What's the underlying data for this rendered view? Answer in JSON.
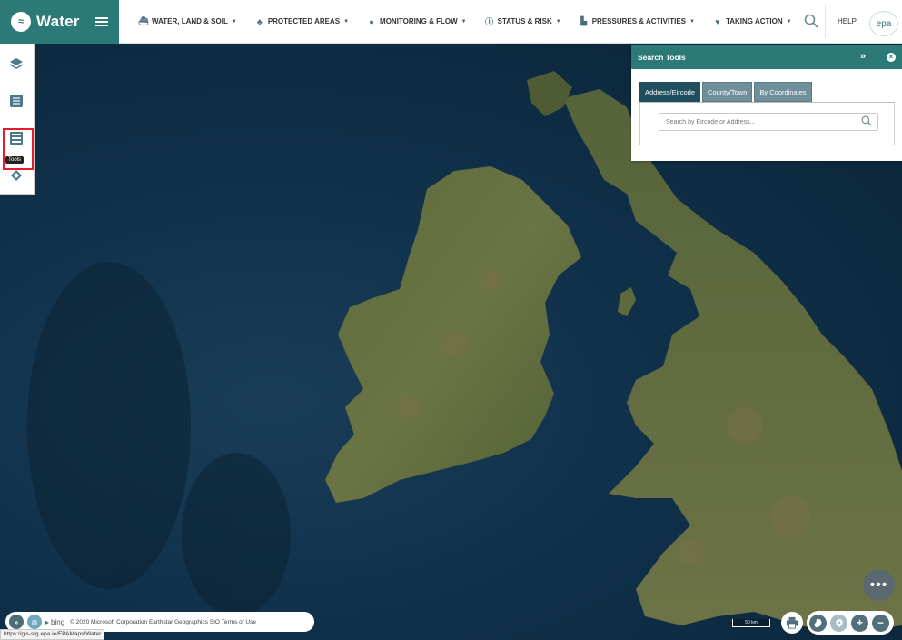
{
  "header": {
    "app_title": "Water",
    "nav": [
      {
        "label": "WATER, LAND & SOIL",
        "icon": "boat-icon"
      },
      {
        "label": "PROTECTED AREAS",
        "icon": "protected-area-icon"
      },
      {
        "label": "MONITORING & FLOW",
        "icon": "water-drop-icon"
      },
      {
        "label": "STATUS & RISK",
        "icon": "info-icon"
      },
      {
        "label": "PRESSURES & ACTIVITIES",
        "icon": "factory-icon"
      },
      {
        "label": "TAKING ACTION",
        "icon": "heart-icon"
      }
    ],
    "help_label": "HELP",
    "logo_text": "epa"
  },
  "left_toolbar": {
    "tools_tooltip": "Tools"
  },
  "search_panel": {
    "title": "Search Tools",
    "tabs": [
      "Address/Eircode",
      "County/Town",
      "By Coordinates"
    ],
    "active_tab": "Address/Eircode",
    "search_placeholder": "Search by Eircode or Address..."
  },
  "attribution": {
    "bing_label": "bing",
    "copyright": "© 2020 Microsoft Corporation Earthstar Geographics SIO Terms of Use"
  },
  "status_url": "https://gis-stg.epa.ie/EPAMaps/Water",
  "scale_label": "50 km",
  "colors": {
    "brand": "#2b7a78",
    "highlight": "#e31d2b",
    "tab_active": "#1f4f5f",
    "tab_inactive": "#6f8f9b"
  }
}
